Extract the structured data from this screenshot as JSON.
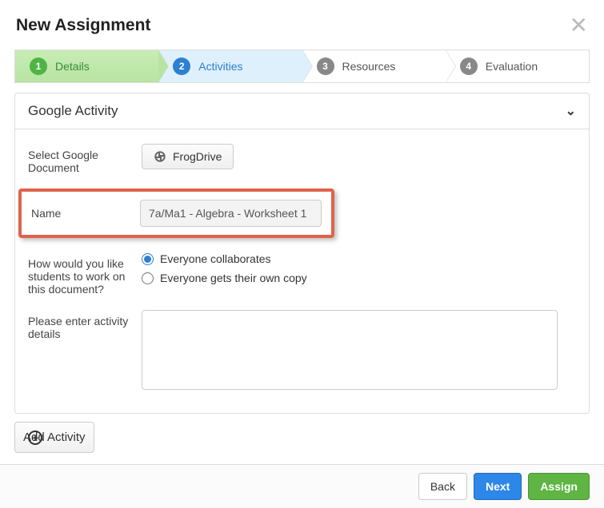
{
  "header": {
    "title": "New Assignment"
  },
  "steps": [
    {
      "num": "1",
      "label": "Details",
      "state": "completed"
    },
    {
      "num": "2",
      "label": "Activities",
      "state": "active"
    },
    {
      "num": "3",
      "label": "Resources",
      "state": "upcoming"
    },
    {
      "num": "4",
      "label": "Evaluation",
      "state": "upcoming"
    }
  ],
  "panel": {
    "title": "Google Activity",
    "select_doc_label": "Select Google Document",
    "frogdrive_label": "FrogDrive",
    "name_label": "Name",
    "name_value": "7a/Ma1 - Algebra - Worksheet 1",
    "work_label": "How would you like students to work on this document?",
    "radio_collab": "Everyone collaborates",
    "radio_own": "Everyone gets their own copy",
    "details_label": "Please enter activity details",
    "details_value": ""
  },
  "add_activity_label": "Add Activity",
  "footer": {
    "back": "Back",
    "next": "Next",
    "assign": "Assign"
  }
}
